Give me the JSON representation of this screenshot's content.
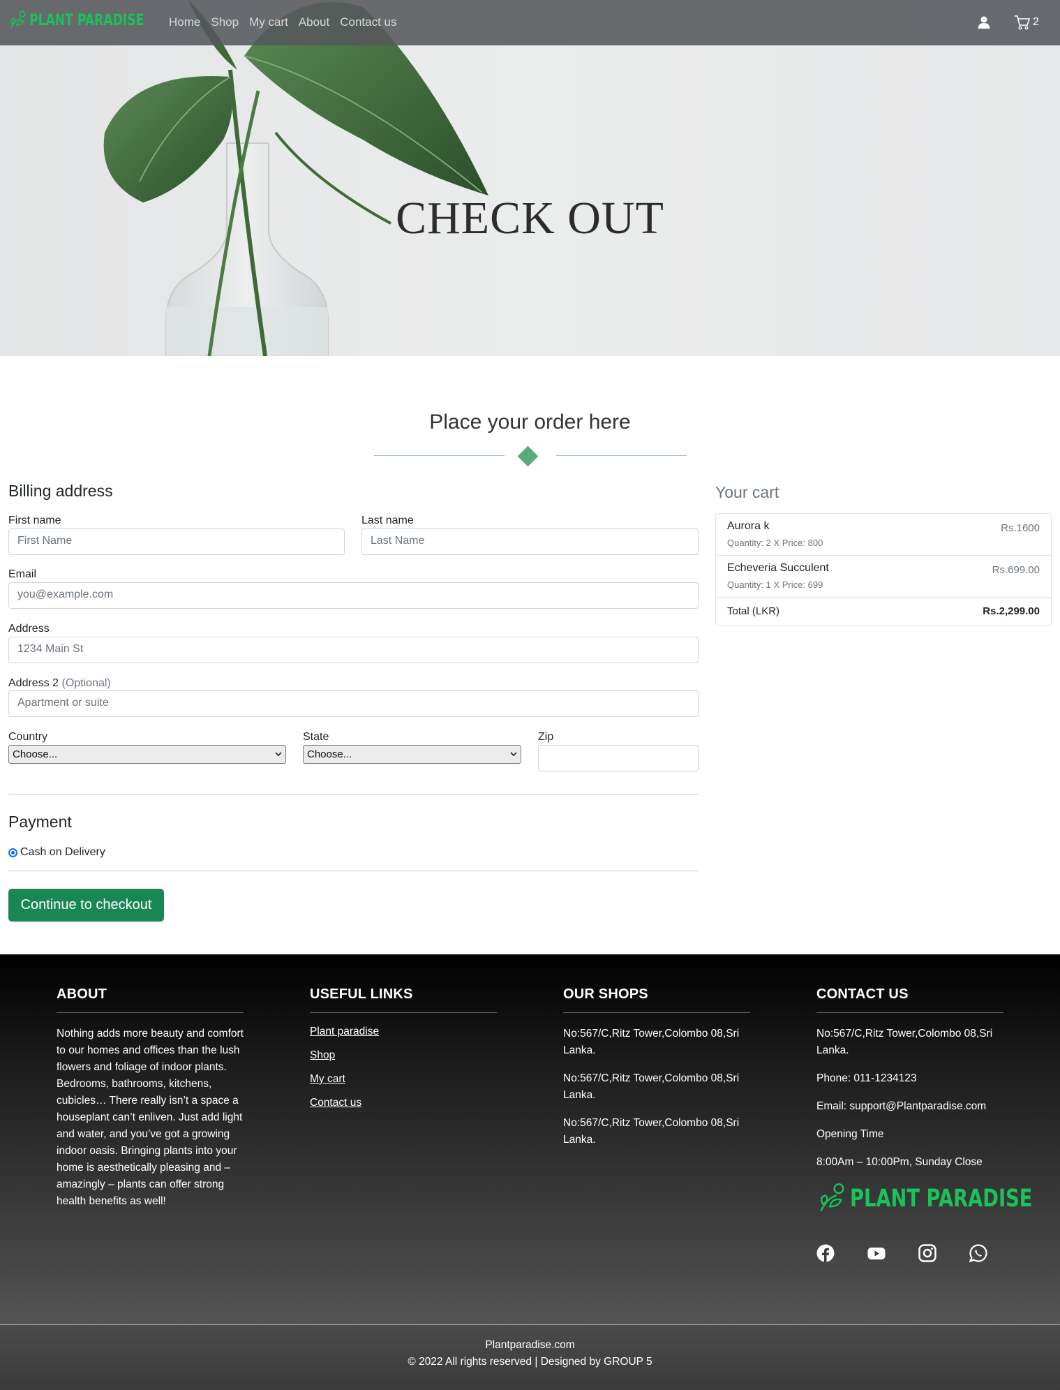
{
  "nav": {
    "brand": "PLANT PARADISE",
    "links": [
      "Home",
      "Shop",
      "My cart",
      "About",
      "Contact us"
    ],
    "cart_count": "2"
  },
  "hero": {
    "title": "CHECK OUT"
  },
  "order": {
    "title": "Place your order here",
    "billing_heading": "Billing address",
    "first_name_label": "First name",
    "first_name_placeholder": "First Name",
    "last_name_label": "Last name",
    "last_name_placeholder": "Last Name",
    "email_label": "Email",
    "email_placeholder": "you@example.com",
    "address_label": "Address",
    "address_placeholder": "1234 Main St",
    "address2_label": "Address 2",
    "address2_optional": "(Optional)",
    "address2_placeholder": "Apartment or suite",
    "country_label": "Country",
    "country_value": "Choose...",
    "state_label": "State",
    "state_value": "Choose...",
    "zip_label": "Zip",
    "payment_heading": "Payment",
    "payment_option": "Cash on Delivery",
    "checkout_button": "Continue to checkout"
  },
  "cart": {
    "heading": "Your cart",
    "items": [
      {
        "name": "Aurora k",
        "meta": "Quantity: 2 X Price: 800",
        "price": "Rs.1600"
      },
      {
        "name": "Echeveria Succulent",
        "meta": "Quantity: 1 X Price: 699",
        "price": "Rs.699.00"
      }
    ],
    "total_label": "Total (LKR)",
    "total_value": "Rs.2,299.00"
  },
  "footer": {
    "about_heading": "ABOUT",
    "about_text": "Nothing adds more beauty and comfort to our homes and offices than the lush flowers and foliage of indoor plants. Bedrooms, bathrooms, kitchens, cubicles… There really isn’t a space a houseplant can’t enliven. Just add light and water, and you’ve got a growing indoor oasis. Bringing plants into your home is aesthetically pleasing and – amazingly – plants can offer strong health benefits as well!",
    "links_heading": "USEFUL LINKS",
    "links": [
      "Plant paradise",
      "Shop",
      "My cart",
      "Contact us"
    ],
    "shops_heading": "OUR SHOPS",
    "shops": [
      "No:567/C,Ritz Tower,Colombo 08,Sri Lanka.",
      "No:567/C,Ritz Tower,Colombo 08,Sri Lanka.",
      "No:567/C,Ritz Tower,Colombo 08,Sri Lanka."
    ],
    "contact_heading": "CONTACT US",
    "contact_address": "No:567/C,Ritz Tower,Colombo 08,Sri Lanka.",
    "contact_phone": "Phone: 011-1234123",
    "contact_email": "Email: support@Plantparadise.com",
    "opening_label": "Opening Time",
    "opening_hours": "8:00Am – 10:00Pm, Sunday Close",
    "brand": "PLANT PARADISE",
    "socials": [
      "facebook-icon",
      "youtube-icon",
      "instagram-icon",
      "whatsapp-icon"
    ],
    "site": "Plantparadise.com",
    "copyright": "© 2022 All rights reserved | Designed by GROUP 5"
  },
  "colors": {
    "brand_green": "#19c25a",
    "button_green": "#198754",
    "diamond_green": "#5aab78",
    "nav_bg": "#55585c"
  }
}
